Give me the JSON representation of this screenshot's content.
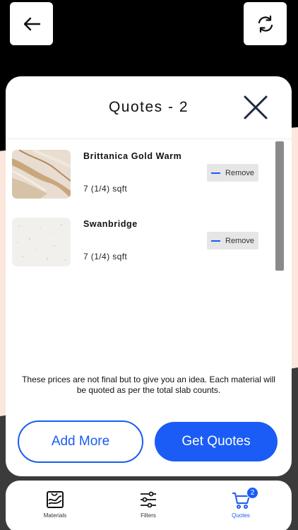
{
  "header": {
    "back_icon": "arrow-left-icon",
    "refresh_icon": "refresh-icon"
  },
  "modal": {
    "title": "Quotes - 2",
    "close_icon": "close-icon",
    "items": [
      {
        "name": "Brittanica Gold Warm",
        "qty": "7 (1/4) sqft",
        "remove_label": "Remove"
      },
      {
        "name": "Swanbridge",
        "qty": "7 (1/4) sqft",
        "remove_label": "Remove"
      }
    ],
    "note": "These prices are not final but to give you an idea. Each material will be quoted as per the total slab counts.",
    "add_more_label": "Add More",
    "get_quotes_label": "Get Quotes"
  },
  "nav": {
    "items": [
      {
        "label": "Materials",
        "icon": "materials-icon"
      },
      {
        "label": "Filters",
        "icon": "filters-icon"
      },
      {
        "label": "Quotes",
        "icon": "cart-icon",
        "badge": "2"
      }
    ]
  },
  "colors": {
    "accent": "#1a5cf5",
    "background": "#000000",
    "peach": "#fbe7dc"
  }
}
